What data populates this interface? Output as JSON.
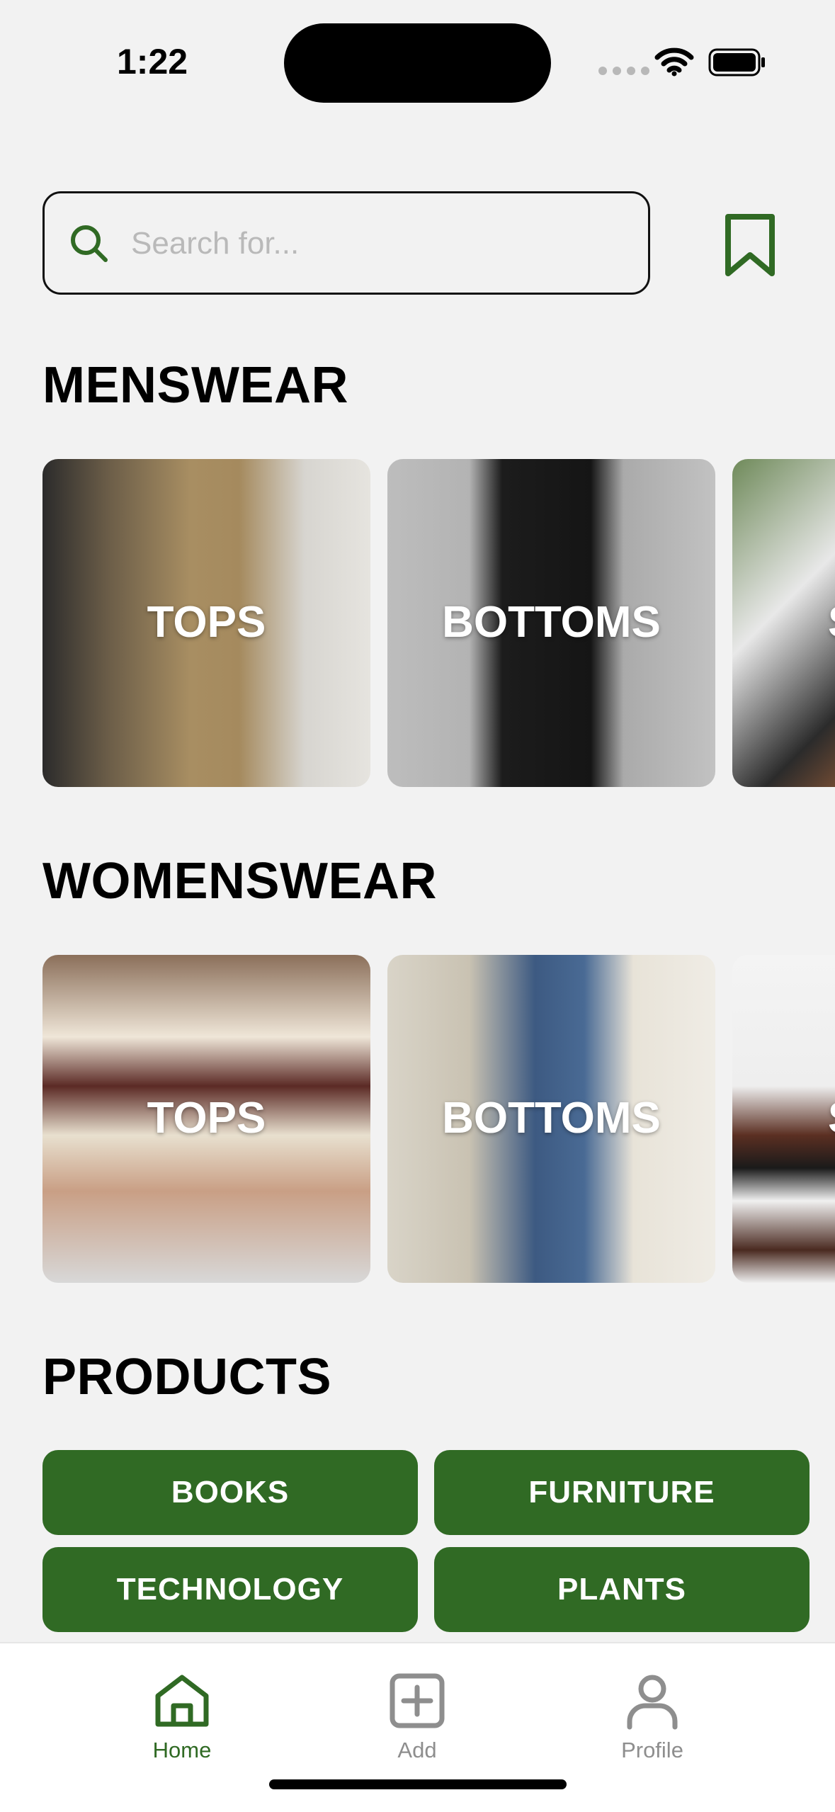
{
  "status_bar": {
    "time": "1:22"
  },
  "search": {
    "placeholder": "Search for..."
  },
  "sections": {
    "menswear": {
      "title": "MENSWEAR",
      "tiles": [
        {
          "label": "TOPS"
        },
        {
          "label": "BOTTOMS"
        },
        {
          "label": "S"
        }
      ]
    },
    "womenswear": {
      "title": "WOMENSWEAR",
      "tiles": [
        {
          "label": "TOPS"
        },
        {
          "label": "BOTTOMS"
        },
        {
          "label": "S"
        }
      ]
    },
    "products": {
      "title": "PRODUCTS",
      "chips": [
        {
          "label": "BOOKS"
        },
        {
          "label": "FURNITURE"
        },
        {
          "label": "TECHNOLOGY"
        },
        {
          "label": "PLANTS"
        }
      ]
    }
  },
  "tab_bar": {
    "items": [
      {
        "label": "Home",
        "icon": "home-icon",
        "active": true
      },
      {
        "label": "Add",
        "icon": "add-square-icon",
        "active": false
      },
      {
        "label": "Profile",
        "icon": "person-icon",
        "active": false
      }
    ]
  },
  "colors": {
    "accent": "#306a24",
    "background": "#f2f2f2",
    "inactive": "#8e8e8e"
  }
}
